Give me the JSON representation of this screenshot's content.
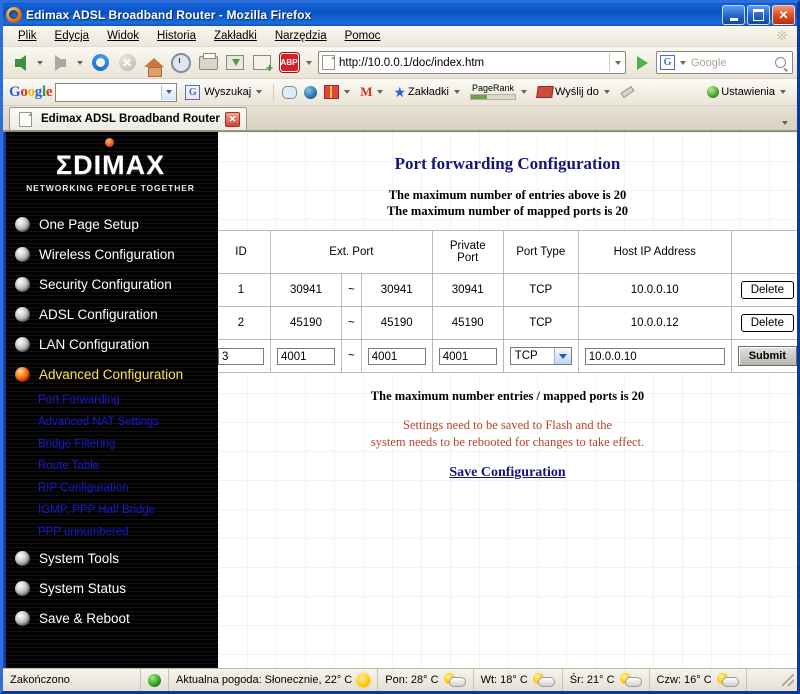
{
  "window": {
    "title": "Edimax ADSL Broadband Router - Mozilla Firefox",
    "app_icon": "firefox-icon",
    "minimize_label": "_",
    "maximize_label": "",
    "close_label": "✕"
  },
  "menubar": {
    "items": [
      {
        "label": "Plik"
      },
      {
        "label": "Edycja"
      },
      {
        "label": "Widok"
      },
      {
        "label": "Historia"
      },
      {
        "label": "Zakładki"
      },
      {
        "label": "Narzędzia"
      },
      {
        "label": "Pomoc"
      }
    ]
  },
  "navbar": {
    "back_icon": "back-arrow-icon",
    "forward_icon": "forward-arrow-icon",
    "reload_icon": "reload-icon",
    "stop_icon": "stop-icon",
    "stop_glyph": "✕",
    "home_icon": "home-icon",
    "history_icon": "clock-icon",
    "print_icon": "printer-icon",
    "download_icon": "download-icon",
    "newtab_icon": "new-page-icon",
    "adblock_icon": "adblock-icon",
    "adblock_label": "ABP",
    "url": "http://10.0.0.1/doc/index.htm",
    "url_page_icon": "page-icon",
    "go_icon": "go-arrow-icon",
    "search_engine_icon": "google-g-icon",
    "search_engine_label": "G",
    "search_placeholder": "Google",
    "search_value": "",
    "search_icon": "magnifier-icon"
  },
  "googlebar": {
    "logo_letters": [
      "G",
      "o",
      "o",
      "g",
      "l",
      "e"
    ],
    "search_value": "",
    "search_button_label": "Wyszukaj",
    "search_button_icon": "google-g-icon",
    "highlight_icon": "speech-bubble-icon",
    "translate_icon": "globe-icon",
    "gift_icon": "gift-icon",
    "gmail_icon": "gmail-m-icon",
    "gmail_label": "M",
    "bookmarks_icon": "star-icon",
    "bookmarks_label": "Zakładki",
    "pagerank_label": "PageRank",
    "send_icon": "send-envelope-icon",
    "send_label": "Wyślij do",
    "highlighter_icon": "highlighter-pencil-icon",
    "settings_icon": "green-orb-icon",
    "settings_label": "Ustawienia"
  },
  "tabstrip": {
    "tabs": [
      {
        "label": "Edimax ADSL Broadband Router",
        "icon": "page-icon",
        "close_label": "✕",
        "active": true
      }
    ],
    "list_all_icon": "chevron-down-icon"
  },
  "sidebar": {
    "logo": {
      "word": "ΣDIMAX",
      "tagline": "NETWORKING PEOPLE TOGETHER",
      "dot_icon": "logo-dot-icon"
    },
    "items": [
      {
        "label": "One Page Setup",
        "icon": "grey-orb-icon",
        "active": false
      },
      {
        "label": "Wireless Configuration",
        "icon": "grey-orb-icon",
        "active": false
      },
      {
        "label": "Security Configuration",
        "icon": "grey-orb-icon",
        "active": false
      },
      {
        "label": "ADSL Configuration",
        "icon": "grey-orb-icon",
        "active": false
      },
      {
        "label": "LAN Configuration",
        "icon": "grey-orb-icon",
        "active": false
      },
      {
        "label": "Advanced Configuration",
        "icon": "red-orb-icon",
        "active": true
      }
    ],
    "subitems": [
      {
        "label": "Port Forwarding"
      },
      {
        "label": "Advanced NAT Settings"
      },
      {
        "label": "Bridge Filtering"
      },
      {
        "label": "Route Table"
      },
      {
        "label": "RIP Configuration"
      },
      {
        "label": "IGMP, PPP Half Bridge"
      },
      {
        "label": "PPP unnumbered"
      }
    ],
    "items_after": [
      {
        "label": "System Tools",
        "icon": "grey-orb-icon",
        "active": false
      },
      {
        "label": "System Status",
        "icon": "grey-orb-icon",
        "active": false
      },
      {
        "label": "Save & Reboot",
        "icon": "grey-orb-icon",
        "active": false
      }
    ]
  },
  "page": {
    "title": "Port forwarding Configuration",
    "subtitle_line1": "The maximum number of entries above is 20",
    "subtitle_line2": "The maximum number of mapped ports is 20",
    "footer_note": "The maximum number entries / mapped ports is 20",
    "warning_line1": "Settings need to be saved to Flash and the",
    "warning_line2": "system needs to be rebooted for changes to take effect.",
    "save_link": "Save Configuration",
    "title_color": "#14147a",
    "warning_color": "#b5442a"
  },
  "table": {
    "headers": [
      "ID",
      "Ext. Port",
      "Private Port",
      "Port Type",
      "Host IP Address",
      ""
    ],
    "tilde": "~",
    "rows": [
      {
        "id": "1",
        "ext_port_from": "30941",
        "ext_port_to": "30941",
        "private_port": "30941",
        "port_type": "TCP",
        "host_ip": "10.0.0.10",
        "action_label": "Delete"
      },
      {
        "id": "2",
        "ext_port_from": "45190",
        "ext_port_to": "45190",
        "private_port": "45190",
        "port_type": "TCP",
        "host_ip": "10.0.0.12",
        "action_label": "Delete"
      }
    ],
    "new_row": {
      "id": "3",
      "ext_port_from": "4001",
      "ext_port_to": "4001",
      "private_port": "4001",
      "port_type": "TCP",
      "host_ip": "10.0.0.10",
      "action_label": "Submit",
      "port_type_caret_icon": "chevron-down-icon"
    }
  },
  "statusbar": {
    "status_text": "Zakończono",
    "status_orb_icon": "green-orb-icon",
    "weather_current": "Aktualna pogoda: Słonecznie, 22° C",
    "weather_current_icon": "sun-icon",
    "forecast": [
      {
        "label": "Pon: 28° C",
        "icon": "sun-cloud-icon"
      },
      {
        "label": "Wt: 18° C",
        "icon": "sun-cloud-icon"
      },
      {
        "label": "Śr: 21° C",
        "icon": "sun-cloud-icon"
      },
      {
        "label": "Czw: 16° C",
        "icon": "sun-cloud-icon"
      }
    ],
    "resize_grip_icon": "resize-grip-icon"
  }
}
